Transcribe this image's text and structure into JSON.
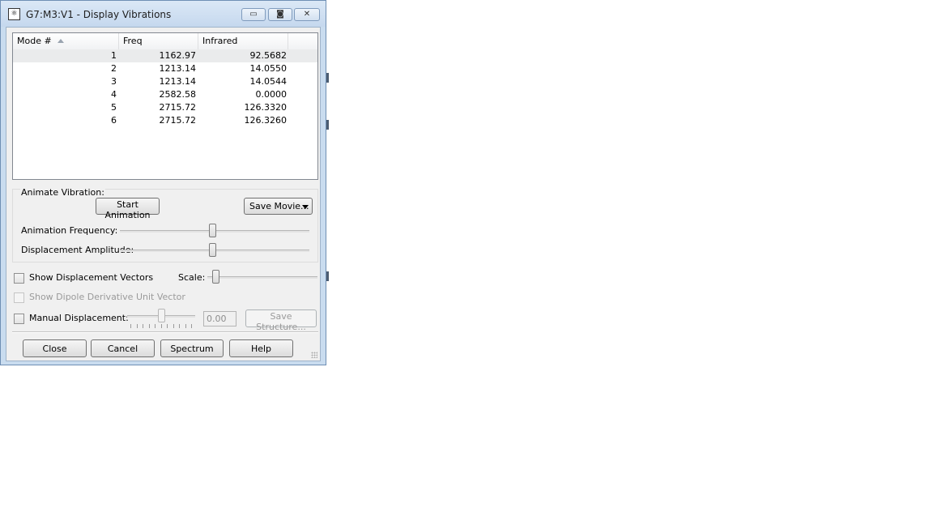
{
  "window": {
    "title": "G7:M3:V1 - Display Vibrations",
    "controls": {
      "minimize": "▭",
      "maximize": "◙",
      "close": "✕"
    }
  },
  "table": {
    "columns": [
      "Mode #",
      "Freq",
      "Infrared"
    ],
    "rows": [
      {
        "mode": "1",
        "freq": "1162.97",
        "ir": "92.5682"
      },
      {
        "mode": "2",
        "freq": "1213.14",
        "ir": "14.0550"
      },
      {
        "mode": "3",
        "freq": "1213.14",
        "ir": "14.0544"
      },
      {
        "mode": "4",
        "freq": "2582.58",
        "ir": "0.0000"
      },
      {
        "mode": "5",
        "freq": "2715.72",
        "ir": "126.3320"
      },
      {
        "mode": "6",
        "freq": "2715.72",
        "ir": "126.3260"
      }
    ],
    "selected_row": 1
  },
  "animate": {
    "group_label": "Animate Vibration:",
    "start_label": "Start Animation",
    "save_movie_label": "Save Movie...",
    "freq_label": "Animation Frequency:",
    "freq_level": 0.49,
    "amp_label": "Displacement Amplitude:",
    "amp_level": 0.49
  },
  "options": {
    "show_vectors_label": "Show Displacement Vectors",
    "scale_label": "Scale:",
    "scale_level": 0.05,
    "show_dipole_label": "Show Dipole Derivative Unit Vector",
    "manual_label": "Manual Displacement:",
    "manual_level": 0.5,
    "manual_value": "0.00",
    "save_structure_label": "Save Structure..."
  },
  "buttons": {
    "close": "Close",
    "cancel": "Cancel",
    "spectrum": "Spectrum",
    "help": "Help"
  }
}
